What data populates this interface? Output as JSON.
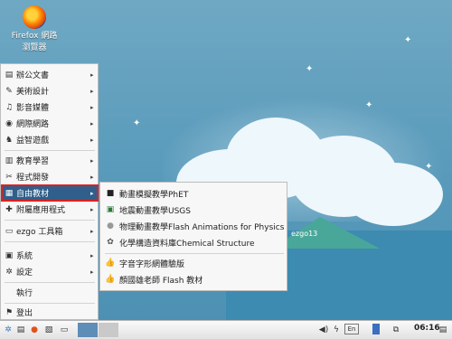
{
  "desktop": {
    "firefox": {
      "line1": "Firefox 網路",
      "line2": "瀏覽器"
    },
    "watermark": "ezgo13"
  },
  "menu": {
    "items": [
      {
        "label": "辦公文書",
        "icon": "document-icon"
      },
      {
        "label": "美術設計",
        "icon": "paint-icon"
      },
      {
        "label": "影音媒體",
        "icon": "media-icon"
      },
      {
        "label": "網際網路",
        "icon": "globe-icon"
      },
      {
        "label": "益智遊戲",
        "icon": "game-icon"
      },
      {
        "label": "教育學習",
        "icon": "book-icon"
      },
      {
        "label": "程式開發",
        "icon": "code-icon"
      },
      {
        "label": "自由教材",
        "icon": "library-icon"
      },
      {
        "label": "附屬應用程式",
        "icon": "tools-icon"
      },
      {
        "label": "ezgo 工具箱",
        "icon": "ezgo-icon"
      },
      {
        "label": "系統",
        "icon": "system-icon"
      },
      {
        "label": "設定",
        "icon": "settings-icon"
      },
      {
        "label": "執行",
        "icon": ""
      },
      {
        "label": "登出",
        "icon": "logout-icon"
      }
    ]
  },
  "submenu": {
    "items": [
      {
        "label": "動畫模擬教學PhET",
        "icon": "phet-icon"
      },
      {
        "label": "地震動畫教學USGS",
        "icon": "usgs-icon"
      },
      {
        "label": "物理動畫教學Flash Animations for Physics",
        "icon": "physics-icon"
      },
      {
        "label": "化學構造資料庫Chemical Structure",
        "icon": "chemistry-icon"
      },
      {
        "label": "字音字形網體驗版",
        "icon": "thumbs-up-icon"
      },
      {
        "label": "顏國雄老師 Flash 教材",
        "icon": "thumbs-up-icon"
      }
    ]
  },
  "taskbar": {
    "clock": "06:16"
  },
  "colors": {
    "accent": "#2f5f8a",
    "highlight_border": "#e02020",
    "desktop": "#5b9cbc"
  }
}
